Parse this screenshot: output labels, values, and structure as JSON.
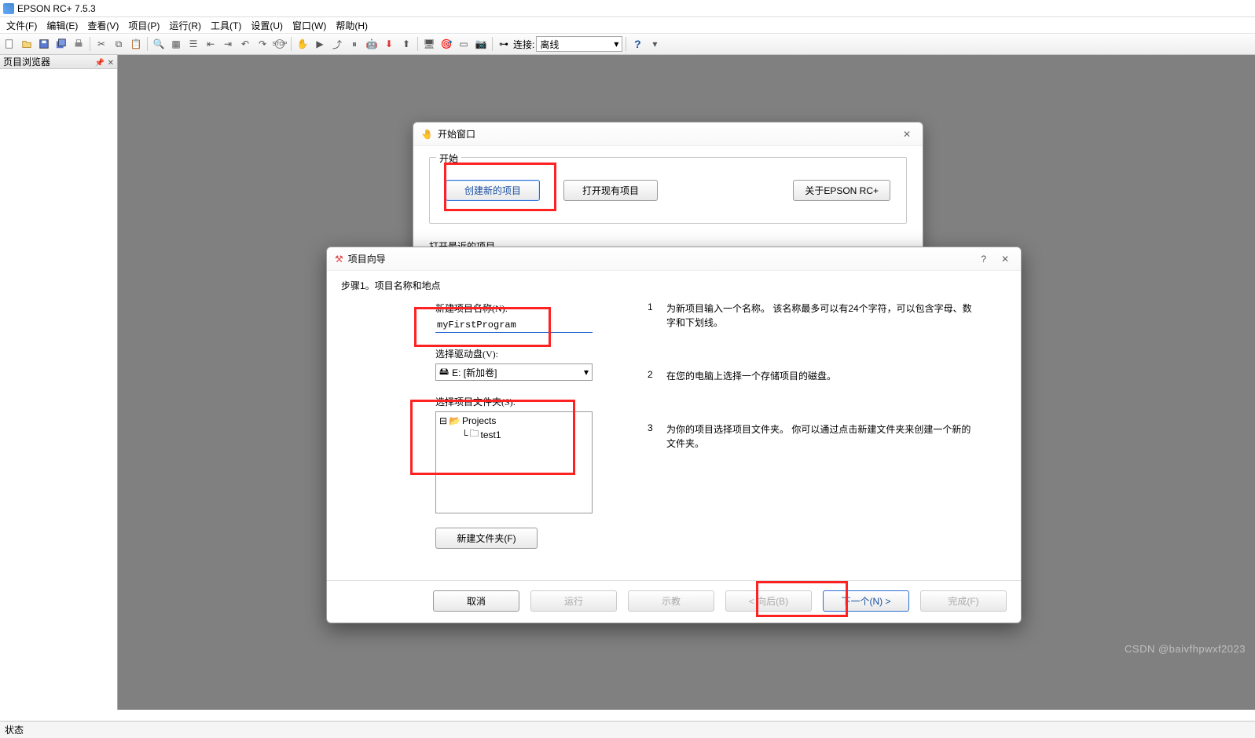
{
  "app": {
    "title": "EPSON RC+ 7.5.3"
  },
  "menu": {
    "file": "文件(F)",
    "edit": "编辑(E)",
    "view": "查看(V)",
    "project": "项目(P)",
    "run": "运行(R)",
    "tools": "工具(T)",
    "setup": "设置(U)",
    "window": "窗口(W)",
    "help": "帮助(H)"
  },
  "toolbar": {
    "connect_label": "连接:",
    "connect_value": "离线"
  },
  "side": {
    "title": "页目浏览器"
  },
  "status": {
    "text": "状态"
  },
  "start_window": {
    "title": "开始窗口",
    "group_label": "开始",
    "create_new": "创建新的项目",
    "open_existing": "打开现有项目",
    "about": "关于EPSON RC+",
    "recent_label": "打开最近的项目"
  },
  "wizard": {
    "title": "项目向导",
    "step_label": "步骤1。项目名称和地点",
    "name_label": "新建项目名称(N):",
    "name_value": "myFirstProgram",
    "drive_label": "选择驱动盘(V):",
    "drive_value": "E: [新加卷]",
    "folder_label": "选择项目文件夹(S):",
    "tree_root": "Projects",
    "tree_child": "test1",
    "new_folder_btn": "新建文件夹(F)",
    "inst1": "为新项目输入一个名称。 该名称最多可以有24个字符，可以包含字母、数字和下划线。",
    "inst2": "在您的电脑上选择一个存储项目的磁盘。",
    "inst3": "为你的项目选择项目文件夹。 你可以通过点击新建文件夹来创建一个新的文件夹。",
    "btn_cancel": "取消",
    "btn_run": "运行",
    "btn_teach": "示教",
    "btn_back": "< 向后(B)",
    "btn_next": "下一个(N) >",
    "btn_finish": "完成(F)"
  },
  "watermark": "CSDN @baivfhpwxf2023"
}
